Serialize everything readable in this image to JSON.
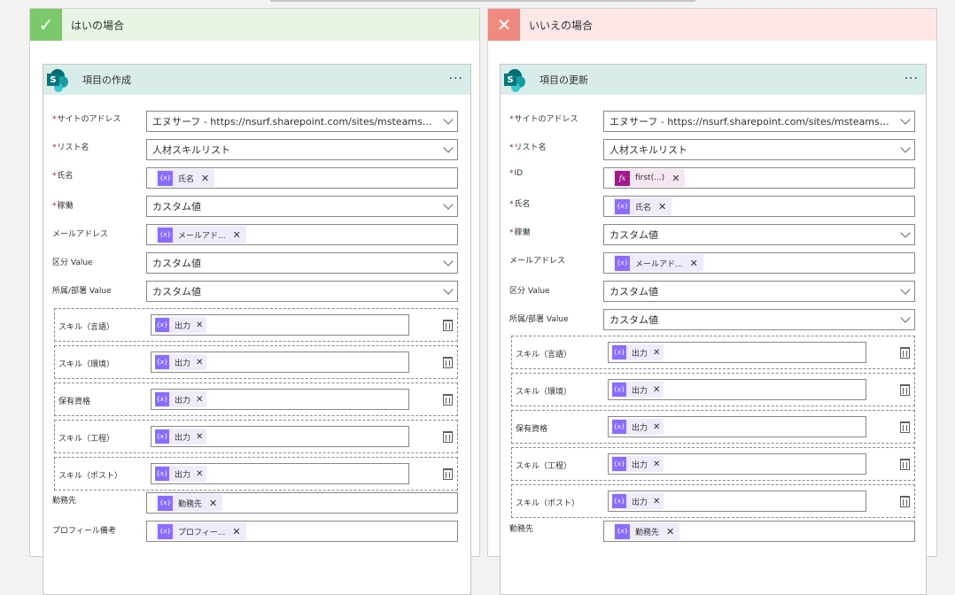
{
  "yes_branch": {
    "title": "はいの場合",
    "card": {
      "title": "項目の作成",
      "more": "···",
      "site_label": "サイトのアドレス",
      "site_value": "エヌサーフ - https://nsurf.sharepoint.com/sites/msteams_9ceb...",
      "list_label": "リスト名",
      "list_value": "人材スキルリスト",
      "name_label": "氏名",
      "name_token": "氏名",
      "work_label": "稼働",
      "work_value": "カスタム値",
      "mail_label": "メールアドレス",
      "mail_token": "メールアド...",
      "kubun_label": "区分 Value",
      "kubun_value": "カスタム値",
      "dept_label": "所属/部署 Value",
      "dept_value": "カスタム値",
      "arrays": [
        {
          "label": "スキル（言語）",
          "token": "出力"
        },
        {
          "label": "スキル（環境）",
          "token": "出力"
        },
        {
          "label": "保有資格",
          "token": "出力"
        },
        {
          "label": "スキル（工程）",
          "token": "出力"
        },
        {
          "label": "スキル（ポスト）",
          "token": "出力"
        }
      ],
      "office_label": "勤務先",
      "office_token": "勤務先",
      "profile_label": "プロフィール備考",
      "profile_token": "プロフィー..."
    }
  },
  "no_branch": {
    "title": "いいえの場合",
    "card": {
      "title": "項目の更新",
      "more": "···",
      "site_label": "サイトのアドレス",
      "site_value": "エヌサーフ - https://nsurf.sharepoint.com/sites/msteams_9ceb...",
      "list_label": "リスト名",
      "list_value": "人材スキルリスト",
      "id_label": "ID",
      "id_token": "first(...)",
      "name_label": "氏名",
      "name_token": "氏名",
      "work_label": "稼働",
      "work_value": "カスタム値",
      "mail_label": "メールアドレス",
      "mail_token": "メールアド...",
      "kubun_label": "区分 Value",
      "kubun_value": "カスタム値",
      "dept_label": "所属/部署 Value",
      "dept_value": "カスタム値",
      "arrays": [
        {
          "label": "スキル（言語）",
          "token": "出力"
        },
        {
          "label": "スキル（環境）",
          "token": "出力"
        },
        {
          "label": "保有資格",
          "token": "出力"
        },
        {
          "label": "スキル（工程）",
          "token": "出力"
        },
        {
          "label": "スキル（ポスト）",
          "token": "出力"
        }
      ],
      "office_label": "勤務先",
      "office_token": "勤務先"
    }
  },
  "common": {
    "required_mark": "*",
    "remove_mark": "✕",
    "dyn_icon": "{x}",
    "fx_icon": "fx",
    "check_icon": "✓",
    "cross_icon": "✕",
    "sp_letter": "S"
  }
}
